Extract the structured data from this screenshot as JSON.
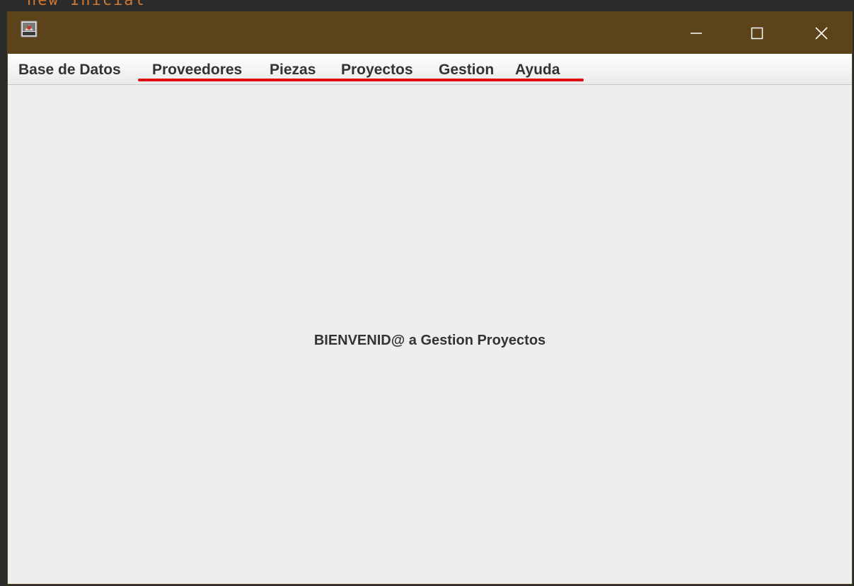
{
  "background": {
    "ghost_text": "new Inicial"
  },
  "window": {
    "title": "",
    "app_icon": "java-app-icon",
    "controls": {
      "minimize_icon": "minimize-icon",
      "maximize_icon": "maximize-icon",
      "close_icon": "close-icon"
    },
    "colors": {
      "titlebar": "#5c4319",
      "annotation": "#e01010"
    }
  },
  "menu": {
    "items": [
      {
        "label": "Base de Datos"
      },
      {
        "label": "Proveedores"
      },
      {
        "label": "Piezas"
      },
      {
        "label": "Proyectos"
      },
      {
        "label": "Gestion"
      },
      {
        "label": "Ayuda"
      }
    ]
  },
  "content": {
    "welcome_text": "BIENVENID@ a Gestion Proyectos"
  }
}
